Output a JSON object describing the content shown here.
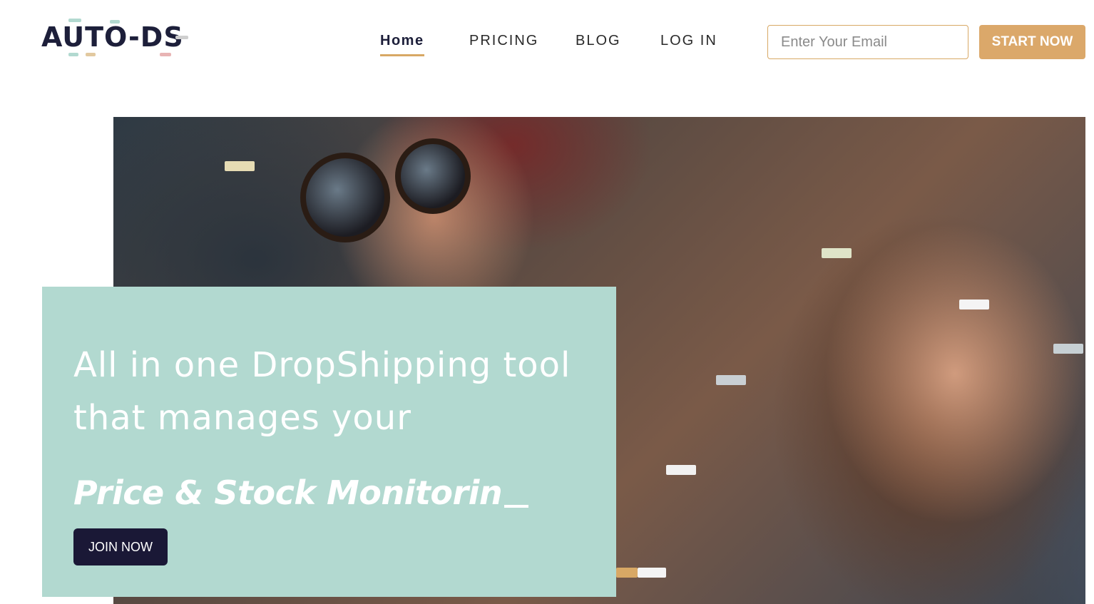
{
  "header": {
    "logo_text": "AUTO-DS",
    "nav": [
      {
        "label": "Home",
        "active": true
      },
      {
        "label": "PRICING",
        "active": false
      },
      {
        "label": "BLOG",
        "active": false
      },
      {
        "label": "LOG IN",
        "active": false
      }
    ],
    "email_placeholder": "Enter Your Email",
    "email_value": "",
    "cta_label": "START NOW"
  },
  "hero": {
    "line1": "All in one DropShipping tool",
    "line2": "that manages your",
    "highlight": "Price & Stock Monitorin",
    "join_label": "JOIN NOW"
  },
  "colors": {
    "accent": "#d8a865",
    "card_background": "#b2d9d0",
    "join_button": "#1a1836",
    "logo_text": "#1d1f3a"
  }
}
